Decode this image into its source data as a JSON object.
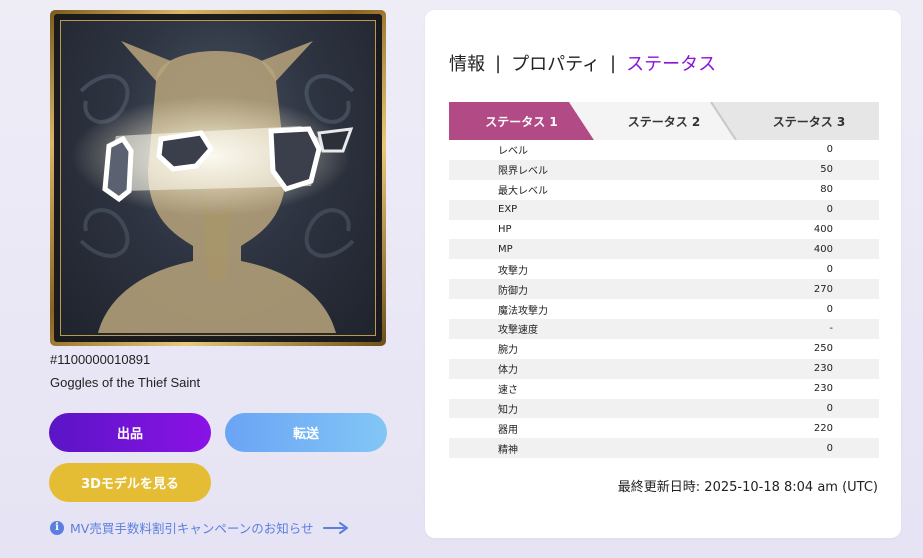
{
  "item": {
    "id": "#1100000010891",
    "name": "Goggles of the Thief Saint"
  },
  "buttons": {
    "sell": "出品",
    "transfer": "転送",
    "view_3d": "3Dモデルを見る"
  },
  "notice": {
    "text": "MV売買手数料割引キャンペーンのお知らせ",
    "icon": "info-icon"
  },
  "nav": {
    "info": "情報",
    "properties": "プロパティ",
    "status": "ステータス",
    "separator": "|"
  },
  "status_tabs": [
    "ステータス 1",
    "ステータス 2",
    "ステータス 3"
  ],
  "stats": [
    {
      "label": "レベル",
      "value": "0"
    },
    {
      "label": "限界レベル",
      "value": "50"
    },
    {
      "label": "最大レベル",
      "value": "80"
    },
    {
      "label": "EXP",
      "value": "0"
    },
    {
      "label": "HP",
      "value": "400"
    },
    {
      "label": "MP",
      "value": "400"
    },
    {
      "label": "攻撃力",
      "value": "0"
    },
    {
      "label": "防御力",
      "value": "270"
    },
    {
      "label": "魔法攻撃力",
      "value": "0"
    },
    {
      "label": "攻撃速度",
      "value": "-"
    },
    {
      "label": "腕力",
      "value": "250"
    },
    {
      "label": "体力",
      "value": "230"
    },
    {
      "label": "速さ",
      "value": "230"
    },
    {
      "label": "知力",
      "value": "0"
    },
    {
      "label": "器用",
      "value": "220"
    },
    {
      "label": "精神",
      "value": "0"
    }
  ],
  "last_updated": "最終更新日時: 2025-10-18 8:04 am (UTC)",
  "colors": {
    "accent_purple": "#8a12d9",
    "active_tab": "#b24a86",
    "sell_button": "#6a14d6",
    "transfer_button": "#76b5f5",
    "view3d_button": "#e4bd35",
    "link_blue": "#5a7fe0"
  }
}
